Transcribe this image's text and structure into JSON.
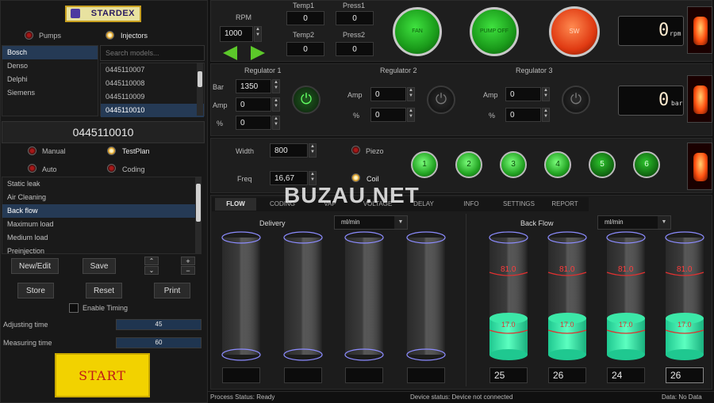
{
  "brand": {
    "logo_text": "STARDEX"
  },
  "category": {
    "pumps_label": "Pumps",
    "injectors_label": "Injectors"
  },
  "manufacturers": [
    "Bosch",
    "Denso",
    "Delphi",
    "Siemens"
  ],
  "models": {
    "search_placeholder": "Search models...",
    "items": [
      "0445110007",
      "0445110008",
      "0445110009",
      "0445110010"
    ],
    "selected": "0445110010"
  },
  "mode": {
    "manual": "Manual",
    "testplan": "TestPlan",
    "auto": "Auto",
    "coding": "Coding"
  },
  "tests": [
    "Static leak",
    "Air Cleaning",
    "Back flow",
    "Maximum load",
    "Medium load",
    "Preinjection"
  ],
  "buttons": {
    "new_edit": "New/Edit",
    "save": "Save",
    "store": "Store",
    "reset": "Reset",
    "print": "Print",
    "start": "START",
    "plus": "+",
    "minus": "−",
    "up": "⌃",
    "down": "⌄"
  },
  "timing": {
    "enable_label": "Enable Timing",
    "adjusting_label": "Adjusting time",
    "adjusting_value": "45",
    "measuring_label": "Measuring time",
    "measuring_value": "60"
  },
  "rpm": {
    "label": "RPM",
    "value": "1000"
  },
  "temp1": {
    "label": "Temp1",
    "value": "0"
  },
  "temp2": {
    "label": "Temp2",
    "value": "0"
  },
  "press1": {
    "label": "Press1",
    "value": "0"
  },
  "press2": {
    "label": "Press2",
    "value": "0"
  },
  "top_buttons": {
    "fan": "FAN",
    "pump": "PUMP OFF",
    "sw": "SW"
  },
  "rpm_display": {
    "value": "0",
    "unit": "rpm"
  },
  "bar_display": {
    "value": "0",
    "unit": "bar"
  },
  "regulator1": {
    "title": "Regulator 1",
    "bar_label": "Bar",
    "bar_value": "1350",
    "amp_label": "Amp",
    "amp_value": "0",
    "pct_label": "%",
    "pct_value": "0"
  },
  "regulator2": {
    "title": "Regulator 2",
    "amp_label": "Amp",
    "amp_value": "0",
    "pct_label": "%",
    "pct_value": "0"
  },
  "regulator3": {
    "title": "Regulator 3",
    "amp_label": "Amp",
    "amp_value": "0",
    "pct_label": "%",
    "pct_value": "0"
  },
  "pulse": {
    "width_label": "Width",
    "width_value": "800",
    "freq_label": "Freq",
    "freq_value": "16,67",
    "piezo_label": "Piezo",
    "coil_label": "Coil"
  },
  "channels": [
    "1",
    "2",
    "3",
    "4",
    "5",
    "6"
  ],
  "watermark": "BUZAU.NET",
  "tabs": [
    "FLOW",
    "CODING",
    "VAP",
    "VOLTAGE",
    "DELAY",
    "INFO",
    "SETTINGS",
    "REPORT"
  ],
  "delivery": {
    "title": "Delivery",
    "unit": "ml/min",
    "values": [
      "",
      "",
      "",
      ""
    ]
  },
  "backflow": {
    "title": "Back Flow",
    "unit": "ml/min",
    "upper_mark": "81.0",
    "lower_mark": "17.0",
    "values": [
      "25",
      "26",
      "24",
      "26"
    ]
  },
  "status": {
    "process": "Process Status: Ready",
    "device": "Device status: Device not connected",
    "data": "Data: No Data"
  },
  "colors": {
    "accent_green": "#2fe8a0",
    "start_yellow": "#f2d200",
    "tab_active": "#e0e0e0"
  }
}
